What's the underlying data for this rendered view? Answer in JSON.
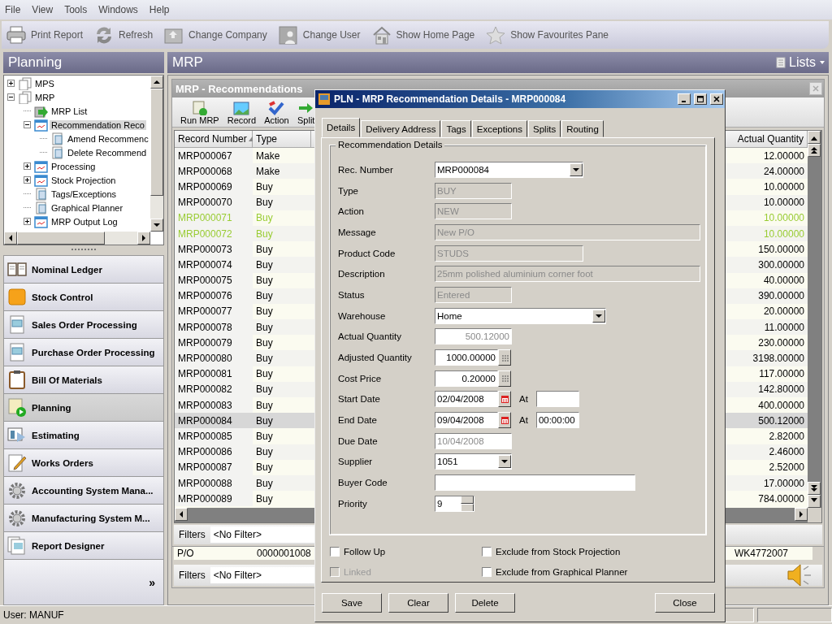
{
  "menu": [
    "File",
    "View",
    "Tools",
    "Windows",
    "Help"
  ],
  "toolbar": [
    {
      "label": "Print Report"
    },
    {
      "label": "Refresh"
    },
    {
      "label": "Change Company"
    },
    {
      "label": "Change User"
    },
    {
      "label": "Show Home Page"
    },
    {
      "label": "Show Favourites Pane"
    }
  ],
  "sidebar": {
    "title": "Planning",
    "tree": [
      {
        "label": "MPS",
        "kind": "folder",
        "expandable": true,
        "expanded": false,
        "selected": false
      },
      {
        "label": "MRP",
        "kind": "folder",
        "expandable": true,
        "expanded": true,
        "selected": false,
        "children": [
          {
            "label": "MRP List",
            "kind": "action",
            "expandable": false,
            "selected": false
          },
          {
            "label": "Recommendation Reco",
            "kind": "screen",
            "expandable": true,
            "expanded": true,
            "selected": true,
            "children": [
              {
                "label": "Amend Recommenc",
                "kind": "page",
                "expandable": false,
                "selected": false
              },
              {
                "label": "Delete Recommend",
                "kind": "page",
                "expandable": false,
                "selected": false
              }
            ]
          },
          {
            "label": "Processing",
            "kind": "screen",
            "expandable": true,
            "expanded": false,
            "selected": false
          },
          {
            "label": "Stock Projection",
            "kind": "screen",
            "expandable": true,
            "expanded": false,
            "selected": false
          },
          {
            "label": "Tags/Exceptions",
            "kind": "page",
            "expandable": false,
            "selected": false
          },
          {
            "label": "Graphical Planner",
            "kind": "page",
            "expandable": false,
            "selected": false
          },
          {
            "label": "MRP Output Log",
            "kind": "screen",
            "expandable": true,
            "expanded": false,
            "selected": false
          }
        ]
      }
    ],
    "modules": [
      {
        "label": "Nominal Ledger",
        "selected": false
      },
      {
        "label": "Stock Control",
        "selected": false
      },
      {
        "label": "Sales Order Processing",
        "selected": false
      },
      {
        "label": "Purchase Order Processing",
        "selected": false
      },
      {
        "label": "Bill Of Materials",
        "selected": false
      },
      {
        "label": "Planning",
        "selected": true
      },
      {
        "label": "Estimating",
        "selected": false
      },
      {
        "label": "Works Orders",
        "selected": false
      },
      {
        "label": "Accounting System Mana...",
        "selected": false
      },
      {
        "label": "Manufacturing System M...",
        "selected": false
      },
      {
        "label": "Report Designer",
        "selected": false
      }
    ],
    "more": "»"
  },
  "workspace": {
    "title": "MRP",
    "lists_button": "Lists",
    "recommendations": {
      "title": "MRP - Recommendations",
      "toolbar": [
        "Run MRP",
        "Record",
        "Action",
        "Split"
      ],
      "columns": [
        {
          "label": "Record Number",
          "sorted": true
        },
        {
          "label": "Type",
          "sorted": false
        },
        {
          "label": "Actual Quantity",
          "sorted": false
        }
      ],
      "rows": [
        {
          "record": "MRP000067",
          "type": "Make",
          "quantity": "12.00000",
          "color": "#000000",
          "selected": false
        },
        {
          "record": "MRP000068",
          "type": "Make",
          "quantity": "24.00000",
          "color": "#000000",
          "selected": false
        },
        {
          "record": "MRP000069",
          "type": "Buy",
          "quantity": "10.00000",
          "color": "#000000",
          "selected": false
        },
        {
          "record": "MRP000070",
          "type": "Buy",
          "quantity": "10.00000",
          "color": "#000000",
          "selected": false
        },
        {
          "record": "MRP000071",
          "type": "Buy",
          "quantity": "10.00000",
          "color": "#99cc33",
          "selected": false
        },
        {
          "record": "MRP000072",
          "type": "Buy",
          "quantity": "10.00000",
          "color": "#99cc33",
          "selected": false
        },
        {
          "record": "MRP000073",
          "type": "Buy",
          "quantity": "150.00000",
          "color": "#000000",
          "selected": false
        },
        {
          "record": "MRP000074",
          "type": "Buy",
          "quantity": "300.00000",
          "color": "#000000",
          "selected": false
        },
        {
          "record": "MRP000075",
          "type": "Buy",
          "quantity": "40.00000",
          "color": "#000000",
          "selected": false
        },
        {
          "record": "MRP000076",
          "type": "Buy",
          "quantity": "390.00000",
          "color": "#000000",
          "selected": false
        },
        {
          "record": "MRP000077",
          "type": "Buy",
          "quantity": "20.00000",
          "color": "#000000",
          "selected": false
        },
        {
          "record": "MRP000078",
          "type": "Buy",
          "quantity": "11.00000",
          "color": "#000000",
          "selected": false
        },
        {
          "record": "MRP000079",
          "type": "Buy",
          "quantity": "230.00000",
          "color": "#000000",
          "selected": false
        },
        {
          "record": "MRP000080",
          "type": "Buy",
          "quantity": "3198.00000",
          "color": "#000000",
          "selected": false
        },
        {
          "record": "MRP000081",
          "type": "Buy",
          "quantity": "117.00000",
          "color": "#000000",
          "selected": false
        },
        {
          "record": "MRP000082",
          "type": "Buy",
          "quantity": "142.80000",
          "color": "#000000",
          "selected": false
        },
        {
          "record": "MRP000083",
          "type": "Buy",
          "quantity": "400.00000",
          "color": "#000000",
          "selected": false
        },
        {
          "record": "MRP000084",
          "type": "Buy",
          "quantity": "500.12000",
          "color": "#000000",
          "selected": true
        },
        {
          "record": "MRP000085",
          "type": "Buy",
          "quantity": "2.82000",
          "color": "#000000",
          "selected": false
        },
        {
          "record": "MRP000086",
          "type": "Buy",
          "quantity": "2.46000",
          "color": "#000000",
          "selected": false
        },
        {
          "record": "MRP000087",
          "type": "Buy",
          "quantity": "2.52000",
          "color": "#000000",
          "selected": false
        },
        {
          "record": "MRP000088",
          "type": "Buy",
          "quantity": "17.00000",
          "color": "#000000",
          "selected": false
        },
        {
          "record": "MRP000089",
          "type": "Buy",
          "quantity": "784.00000",
          "color": "#000000",
          "selected": false
        }
      ],
      "filters": {
        "label": "Filters",
        "value": "<No Filter>"
      }
    },
    "lower_list": {
      "rows": [
        {
          "column_1": "P/O",
          "column_2": "0000001008",
          "column_3": "WK4772007"
        }
      ],
      "filters": {
        "label": "Filters",
        "value": "<No Filter>"
      }
    }
  },
  "dialog": {
    "title": "PLN - MRP Recommendation Details - MRP000084",
    "tabs": [
      {
        "label": "Details",
        "selected": true
      },
      {
        "label": "Delivery Address",
        "selected": false
      },
      {
        "label": "Tags",
        "selected": false
      },
      {
        "label": "Exceptions",
        "selected": false
      },
      {
        "label": "Splits",
        "selected": false
      },
      {
        "label": "Routing",
        "selected": false
      }
    ],
    "group": "Recommendation Details",
    "fields": [
      {
        "label": "Rec. Number",
        "kind": "combo",
        "value": "MRP000084"
      },
      {
        "label": "Type",
        "kind": "readonly",
        "value": "BUY"
      },
      {
        "label": "Action",
        "kind": "readonly",
        "value": "NEW"
      },
      {
        "label": "Message",
        "kind": "readonly",
        "value": "New P/O"
      },
      {
        "label": "Product Code",
        "kind": "readonly",
        "value": "STUDS"
      },
      {
        "label": "Description",
        "kind": "readonly",
        "value": "25mm polished aluminium corner foot"
      },
      {
        "label": "Status",
        "kind": "readonly",
        "value": "Entered"
      },
      {
        "label": "Warehouse",
        "kind": "combo",
        "value": "Home"
      },
      {
        "label": "Actual Quantity",
        "kind": "amount",
        "value": "500.12000"
      },
      {
        "label": "Adjusted Quantity",
        "kind": "calc",
        "value": "1000.00000"
      },
      {
        "label": "Cost Price",
        "kind": "calc",
        "value": "0.20000"
      },
      {
        "label": "Start Date",
        "kind": "date",
        "value": "02/04/2008",
        "at": "At"
      },
      {
        "label": "End Date",
        "kind": "date",
        "value": "09/04/2008",
        "at": "At",
        "time": "00:00:00"
      },
      {
        "label": "Due Date",
        "kind": "display",
        "value": "10/04/2008"
      },
      {
        "label": "Supplier",
        "kind": "combo",
        "value": "1051"
      },
      {
        "label": "Buyer Code",
        "kind": "text"
      },
      {
        "label": "Priority",
        "kind": "spinner",
        "value": "9"
      }
    ],
    "checkboxes": [
      {
        "label": "Follow Up",
        "checked": false,
        "disabled": false
      },
      {
        "label": "Linked",
        "checked": false,
        "disabled": true
      },
      {
        "label": "Exclude from Stock Projection",
        "checked": false,
        "disabled": false
      },
      {
        "label": "Exclude from Graphical Planner",
        "checked": false,
        "disabled": false
      }
    ],
    "buttons": [
      "Save",
      "Clear",
      "Delete",
      "Close"
    ]
  },
  "status_bar": {
    "user": "User: MANUF"
  }
}
